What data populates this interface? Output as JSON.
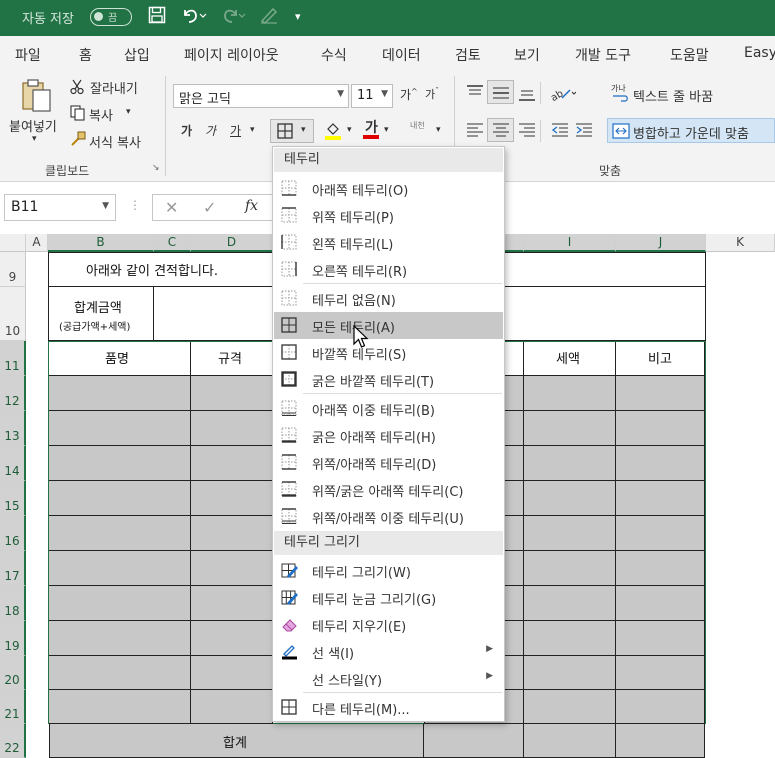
{
  "titlebar": {
    "autosave_label": "자동 저장",
    "autosave_state": "끔",
    "icons": [
      "save-icon",
      "undo-icon",
      "redo-icon",
      "draw-icon",
      "customize-icon"
    ]
  },
  "tabs": [
    "파일",
    "홈",
    "삽입",
    "페이지 레이아웃",
    "수식",
    "데이터",
    "검토",
    "보기",
    "개발 도구",
    "도움말",
    "Easy"
  ],
  "active_tab": "홈",
  "ribbon": {
    "clipboard": {
      "paste": "붙여넣기",
      "cut": "잘라내기",
      "copy": "복사",
      "format_painter": "서식 복사",
      "group_label": "클립보드"
    },
    "font": {
      "name": "맑은 고딕",
      "size": "11",
      "bold": "가",
      "italic": "가",
      "underline": "가",
      "grow": "가",
      "shrink": "가",
      "phonetic": "내천"
    },
    "alignment": {
      "wrap_text": "텍스트 줄 바꿈",
      "merge_center": "병합하고 가운데 맞춤",
      "group_label": "맞춤"
    }
  },
  "formula_bar": {
    "name_box": "B11",
    "fx": "fx"
  },
  "columns": [
    "A",
    "B",
    "C",
    "D",
    "I",
    "J",
    "K"
  ],
  "rows": [
    "9",
    "10",
    "11",
    "12",
    "13",
    "14",
    "15",
    "16",
    "17",
    "18",
    "19",
    "20",
    "21",
    "22"
  ],
  "sheet": {
    "b9": "아래와 같이 견적합니다.",
    "b10_line1": "합계금액",
    "b10_line2": "(공급가액+세액)",
    "hdr_item": "품명",
    "hdr_spec": "규격",
    "hdr_tax": "세액",
    "hdr_note": "비고",
    "total": "합계"
  },
  "menu": {
    "section1": "테두리",
    "section2": "테두리 그리기",
    "items": [
      {
        "label": "아래쪽 테두리(O)",
        "icon": "border-bottom-icon"
      },
      {
        "label": "위쪽 테두리(P)",
        "icon": "border-top-icon"
      },
      {
        "label": "왼쪽 테두리(L)",
        "icon": "border-left-icon"
      },
      {
        "label": "오른쪽 테두리(R)",
        "icon": "border-right-icon"
      },
      {
        "label": "테두리 없음(N)",
        "icon": "no-border-icon"
      },
      {
        "label": "모든 테두리(A)",
        "icon": "all-borders-icon"
      },
      {
        "label": "바깥쪽 테두리(S)",
        "icon": "outside-borders-icon"
      },
      {
        "label": "굵은 바깥쪽 테두리(T)",
        "icon": "thick-outside-borders-icon"
      },
      {
        "label": "아래쪽 이중 테두리(B)",
        "icon": "bottom-double-border-icon"
      },
      {
        "label": "굵은 아래쪽 테두리(H)",
        "icon": "thick-bottom-border-icon"
      },
      {
        "label": "위쪽/아래쪽 테두리(D)",
        "icon": "top-bottom-border-icon"
      },
      {
        "label": "위쪽/굵은 아래쪽 테두리(C)",
        "icon": "top-thick-bottom-border-icon"
      },
      {
        "label": "위쪽/아래쪽 이중 테두리(U)",
        "icon": "top-double-bottom-border-icon"
      }
    ],
    "draw_items": [
      {
        "label": "테두리 그리기(W)",
        "icon": "draw-border-icon"
      },
      {
        "label": "테두리 눈금 그리기(G)",
        "icon": "draw-border-grid-icon"
      },
      {
        "label": "테두리 지우기(E)",
        "icon": "erase-border-icon"
      },
      {
        "label": "선 색(I)",
        "icon": "line-color-icon"
      },
      {
        "label": "선 스타일(Y)",
        "icon": "line-style-icon"
      },
      {
        "label": "다른 테두리(M)...",
        "icon": "more-borders-icon"
      }
    ],
    "hover_index": 5
  },
  "colors": {
    "accent": "#217346",
    "cell_fill": "#c8c8c8",
    "menu_hover": "#c8c8c8"
  }
}
